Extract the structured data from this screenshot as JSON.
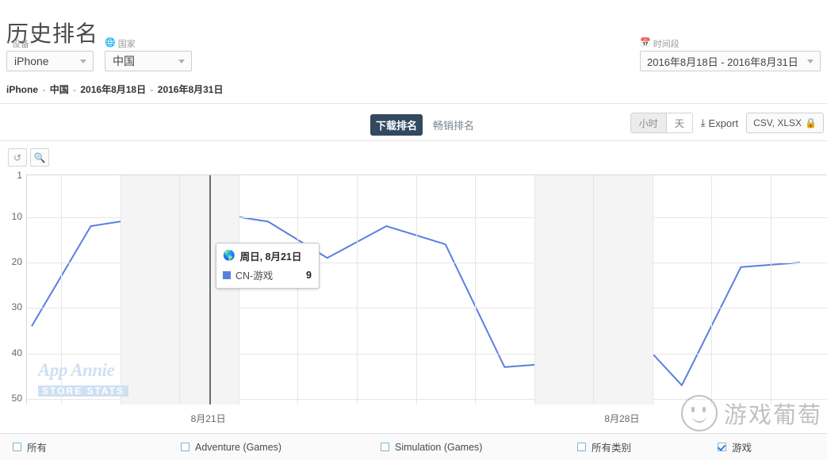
{
  "header": {
    "title": "历史排名",
    "device": {
      "label": "设备",
      "icon": "device-icon",
      "value": "iPhone"
    },
    "country": {
      "label": "国家",
      "icon": "globe-icon",
      "value": "中国"
    },
    "daterange": {
      "label": "时间段",
      "icon": "calendar-icon",
      "value": "2016年8月18日 - 2016年8月31日"
    },
    "breadcrumb": [
      "iPhone",
      "中国",
      "2016年8月18日",
      "2016年8月31日"
    ],
    "breadcrumb_separator": "-"
  },
  "toolbar": {
    "tabs": [
      {
        "label": "下载排名",
        "active": true
      },
      {
        "label": "畅销排名",
        "active": false
      }
    ],
    "granularity": [
      {
        "label": "小时",
        "active": true
      },
      {
        "label": "天",
        "active": false
      }
    ],
    "export_label": "Export",
    "export_icon": "download-icon",
    "csv_label": "CSV, XLSX",
    "csv_icon": "lock-icon"
  },
  "chart_controls": {
    "reset_icon": "reset-icon",
    "reset_glyph": "↺",
    "zoom_icon": "zoom-in-icon",
    "zoom_glyph": "⌕"
  },
  "tooltip": {
    "icon": "globe-icon",
    "date": "周日, 8月21日",
    "series": "CN-游戏",
    "value": "9",
    "color": "#5b7fe0"
  },
  "watermark": {
    "line1": "App Annie",
    "line2": "STORE STATS"
  },
  "brand": {
    "text": "游戏葡萄",
    "icon": "smiley-face-icon"
  },
  "legend": [
    {
      "label": "所有",
      "checked": false
    },
    {
      "label": "Adventure (Games)",
      "checked": false
    },
    {
      "label": "Simulation (Games)",
      "checked": false
    },
    {
      "label": "所有类别",
      "checked": false
    },
    {
      "label": "游戏",
      "checked": true
    }
  ],
  "chart_data": {
    "type": "line",
    "title": "历史排名",
    "xlabel": "",
    "ylabel": "",
    "grid": true,
    "legend_position": "bottom",
    "yaxis_inverted": true,
    "ylim": [
      1,
      50
    ],
    "yticks": [
      1,
      10,
      20,
      30,
      40,
      50
    ],
    "xticks": [
      "8月21日",
      "8月28日"
    ],
    "x": [
      "2016-08-18",
      "2016-08-19",
      "2016-08-20",
      "2016-08-21",
      "2016-08-22",
      "2016-08-23",
      "2016-08-24",
      "2016-08-25",
      "2016-08-26",
      "2016-08-27",
      "2016-08-28",
      "2016-08-29",
      "2016-08-30",
      "2016-08-31"
    ],
    "highlight_x": "2016-08-21",
    "shaded_bands": [
      [
        "2016-08-20",
        "2016-08-21"
      ],
      [
        "2016-08-27",
        "2016-08-28"
      ]
    ],
    "series": [
      {
        "name": "CN-游戏",
        "color": "#5b7fe0",
        "values": [
          34,
          12,
          10,
          9,
          11,
          19,
          12,
          16,
          43,
          42,
          33,
          47,
          21,
          20
        ]
      }
    ]
  }
}
